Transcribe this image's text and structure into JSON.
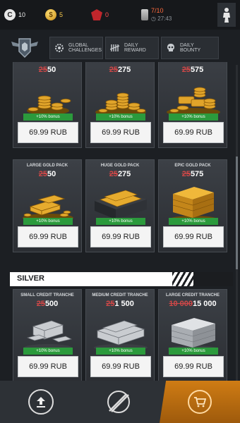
{
  "status": {
    "credits": "10",
    "gold": "5",
    "medals": "0",
    "fuel": "7/10",
    "timer": "27:43"
  },
  "nav": {
    "tabs": [
      {
        "label": "GLOBAL CHALLENGES",
        "icon": "gear-badge-icon"
      },
      {
        "label": "DAILY REWARD",
        "icon": "tally-icon"
      },
      {
        "label": "DAILY BOUNTY",
        "icon": "skull-icon"
      }
    ]
  },
  "gold_row1": [
    {
      "title": "",
      "old": "25",
      "amount": "50",
      "bonus": "+10% bonus",
      "price": "69.99 RUB"
    },
    {
      "title": "",
      "old": "25",
      "amount": "275",
      "bonus": "+10% bonus",
      "price": "69.99 RUB"
    },
    {
      "title": "",
      "old": "25",
      "amount": "575",
      "bonus": "+10% bonus",
      "price": "69.99 RUB"
    }
  ],
  "gold_row2": [
    {
      "title": "LARGE GOLD PACK",
      "old": "25",
      "amount": "50",
      "bonus": "+10% bonus",
      "price": "69.99 RUB"
    },
    {
      "title": "HUGE GOLD PACK",
      "old": "25",
      "amount": "275",
      "bonus": "+10% bonus",
      "price": "69.99 RUB"
    },
    {
      "title": "EPIC GOLD PACK",
      "old": "25",
      "amount": "575",
      "bonus": "+10% bonus",
      "price": "69.99 RUB"
    }
  ],
  "silver_section": {
    "label": "SILVER"
  },
  "silver_row": [
    {
      "title": "SMALL CREDIT TRANCHE",
      "old": "25",
      "amount": "500",
      "bonus": "+10% bonus",
      "price": "69.99 RUB"
    },
    {
      "title": "MEDIUM CREDIT TRANCHE",
      "old": "25",
      "amount": "1 500",
      "bonus": "+10% bonus",
      "price": "69.99 RUB"
    },
    {
      "title": "LARGE CREDIT TRANCHE",
      "old": "10 000",
      "amount": "15 000",
      "bonus": "+10% bonus",
      "price": "69.99 RUB"
    }
  ],
  "colors": {
    "accent": "#cf7c14",
    "bonus": "#2b9a3c",
    "strike": "#d04848",
    "background": "#1c1f23"
  }
}
